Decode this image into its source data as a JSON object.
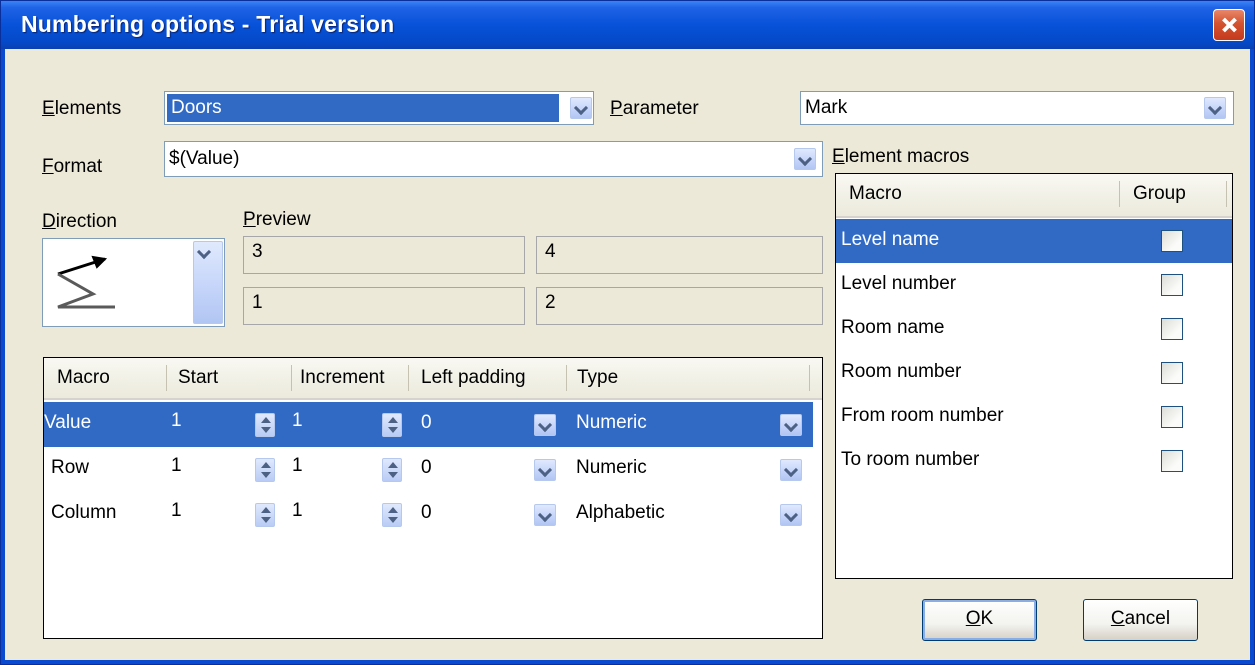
{
  "window": {
    "title": "Numbering options - Trial version"
  },
  "elements": {
    "label": "Elements",
    "accel": "E",
    "value": "Doors"
  },
  "parameter": {
    "label": "Parameter",
    "accel": "P",
    "value": "Mark"
  },
  "format": {
    "label": "Format",
    "accel": "F",
    "value": "$(Value)"
  },
  "direction": {
    "label": "Direction",
    "accel": "D",
    "icon": "z-direction-icon"
  },
  "preview": {
    "label": "Preview",
    "accel": "P",
    "cells": [
      "3",
      "4",
      "1",
      "2"
    ]
  },
  "macro_grid": {
    "headers": [
      "Macro",
      "Start",
      "Increment",
      "Left padding",
      "Type"
    ],
    "rows": [
      {
        "macro": "Value",
        "start": "1",
        "increment": "1",
        "padding": "0",
        "type": "Numeric"
      },
      {
        "macro": "Row",
        "start": "1",
        "increment": "1",
        "padding": "0",
        "type": "Numeric"
      },
      {
        "macro": "Column",
        "start": "1",
        "increment": "1",
        "padding": "0",
        "type": "Alphabetic"
      }
    ]
  },
  "element_macros": {
    "label": "Element macros",
    "accel": "E",
    "headers": [
      "Macro",
      "Group"
    ],
    "items": [
      {
        "name": "Level name",
        "group": false
      },
      {
        "name": "Level number",
        "group": false
      },
      {
        "name": "Room name",
        "group": false
      },
      {
        "name": "Room number",
        "group": false
      },
      {
        "name": "From room number",
        "group": false
      },
      {
        "name": "To room number",
        "group": false
      }
    ]
  },
  "buttons": {
    "ok": "OK",
    "ok_accel": "O",
    "cancel": "Cancel",
    "cancel_accel": "C"
  },
  "colors": {
    "title_bar": "#0752d9",
    "selection": "#316ac5",
    "dialog_bg": "#ece9d8"
  }
}
